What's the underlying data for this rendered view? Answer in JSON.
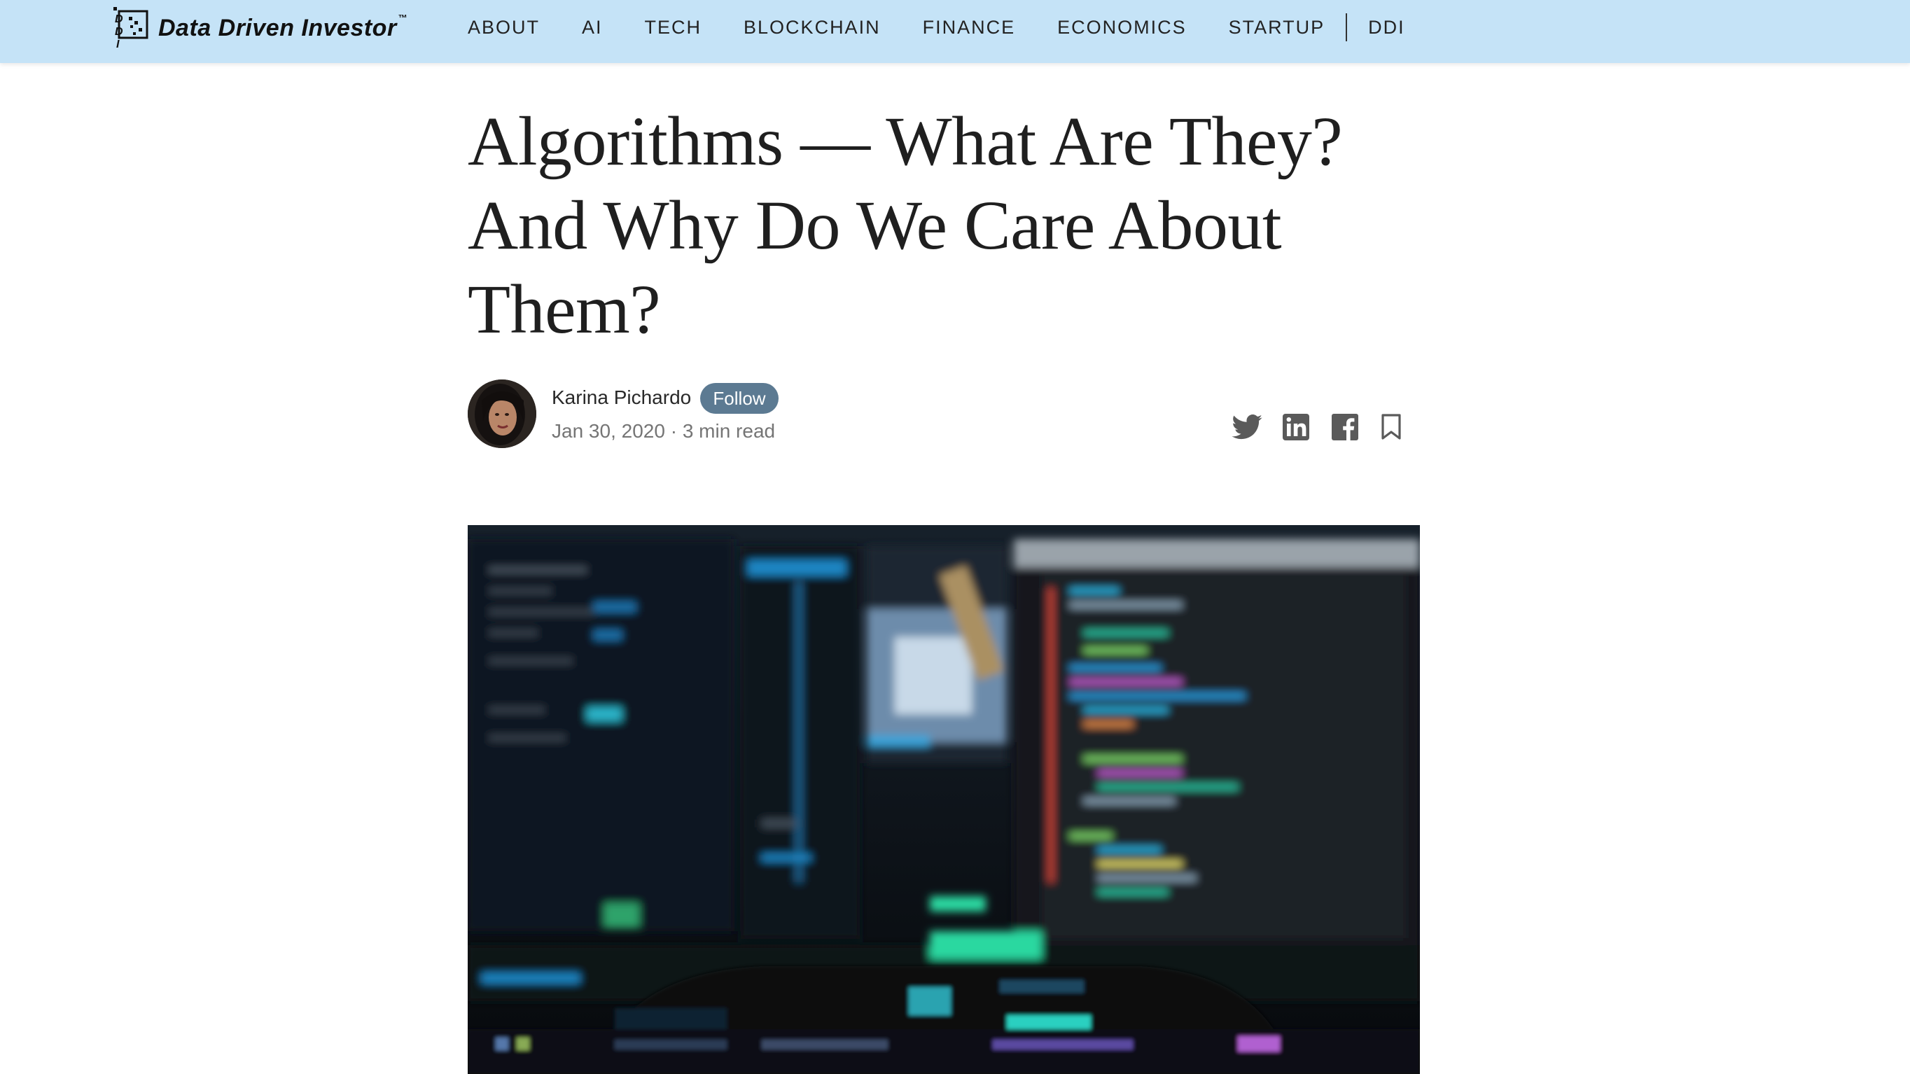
{
  "header": {
    "brand": {
      "name": "Data Driven Investor",
      "tm": "™",
      "logo_letters": "DDI"
    },
    "nav": [
      "ABOUT",
      "AI",
      "TECH",
      "BLOCKCHAIN",
      "FINANCE",
      "ECONOMICS",
      "STARTUP",
      "DDI"
    ],
    "background": "#c5e3f7"
  },
  "article": {
    "title_lines": [
      "Algorithms — What Are They?",
      "And Why Do We Care About",
      "Them?"
    ],
    "author": {
      "name": "Karina Pichardo",
      "follow_label": "Follow",
      "date": "Jan 30, 2020",
      "read_time": "3 min read",
      "separator": "·"
    },
    "share_icons": [
      "twitter-icon",
      "linkedin-icon",
      "facebook-icon",
      "bookmark-icon"
    ],
    "hero_image": "blurred photo of computer monitors showing code"
  },
  "colors": {
    "accent": "#5c7a92",
    "text": "#242424",
    "muted": "#757575"
  }
}
